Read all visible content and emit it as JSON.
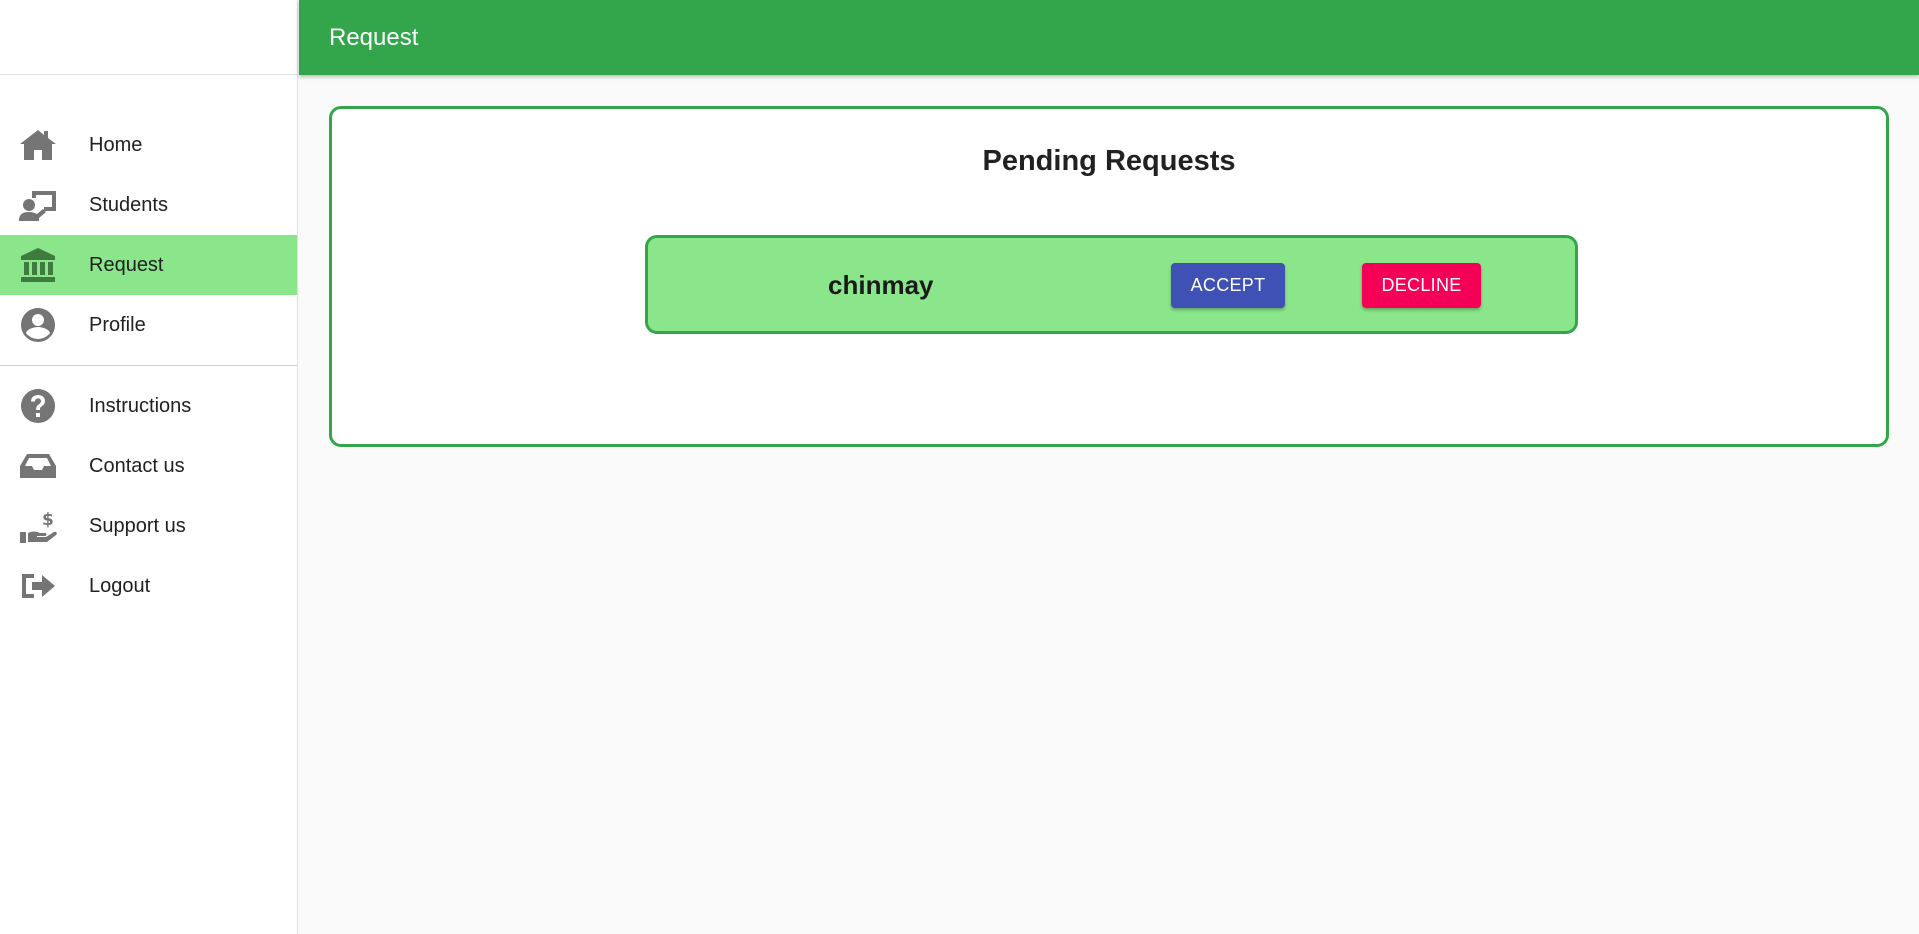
{
  "appbar": {
    "title": "Request"
  },
  "sidebar": {
    "primary_items": [
      {
        "label": "Home",
        "icon": "home-icon"
      },
      {
        "label": "Students",
        "icon": "presentation-icon"
      },
      {
        "label": "Request",
        "icon": "bank-icon",
        "active": true
      },
      {
        "label": "Profile",
        "icon": "account-circle-icon"
      }
    ],
    "secondary_items": [
      {
        "label": "Instructions",
        "icon": "help-circle-icon"
      },
      {
        "label": "Contact us",
        "icon": "inbox-icon"
      },
      {
        "label": "Support us",
        "icon": "hand-dollar-icon"
      },
      {
        "label": "Logout",
        "icon": "logout-icon"
      }
    ]
  },
  "main": {
    "title": "Pending Requests",
    "requests": [
      {
        "name": "chinmay",
        "accept_label": "ACCEPT",
        "decline_label": "DECLINE"
      }
    ]
  },
  "colors": {
    "primary_green": "#33a64c",
    "active_green": "#8be68b",
    "accept_blue": "#3f51b5",
    "decline_pink": "#f50057"
  }
}
